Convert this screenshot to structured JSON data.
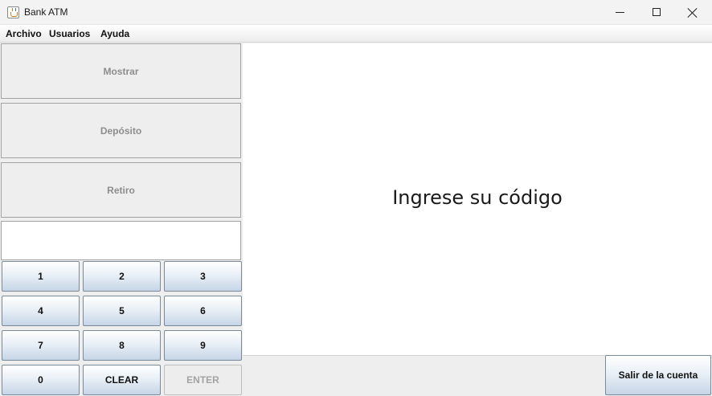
{
  "window": {
    "title": "Bank ATM",
    "controls": [
      "minimize-icon",
      "maximize-icon",
      "close-icon"
    ]
  },
  "menu": {
    "items": [
      "Archivo",
      "Usuarios",
      "Ayuda"
    ]
  },
  "side_buttons": {
    "show": "Mostrar",
    "deposit": "Depósito",
    "withdraw": "Retiro"
  },
  "code_input": {
    "value": ""
  },
  "keypad": {
    "keys": [
      "1",
      "2",
      "3",
      "4",
      "5",
      "6",
      "7",
      "8",
      "9",
      "0",
      "CLEAR",
      "ENTER"
    ]
  },
  "display": {
    "message": "Ingrese su código"
  },
  "footer": {
    "logout_label": "Salir de la cuenta"
  },
  "colors": {
    "panel_bg": "#eeeeee",
    "display_bg": "#ffffff",
    "disabled_text": "#8d8d8d"
  }
}
